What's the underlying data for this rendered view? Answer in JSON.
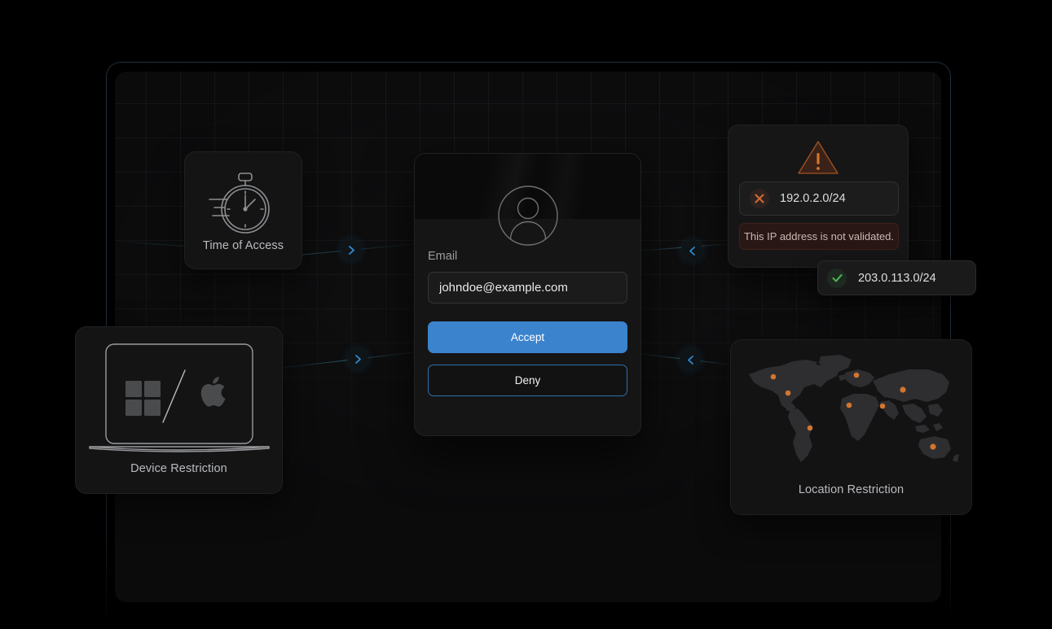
{
  "nodes": {
    "time_of_access": {
      "label": "Time of Access",
      "icon": "stopwatch-icon"
    },
    "device_restriction": {
      "label": "Device Restriction",
      "icon": "laptop-devices-icon"
    },
    "location_restriction": {
      "label": "Location Restriction",
      "icon": "world-map-icon"
    }
  },
  "consent_card": {
    "avatar_icon": "user-avatar-icon",
    "email_label": "Email",
    "email_value": "johndoe@example.com",
    "email_placeholder": "johndoe@example.com",
    "accept_label": "Accept",
    "deny_label": "Deny"
  },
  "ip_panel": {
    "warning_icon": "warning-triangle-icon",
    "invalid_icon": "x-mark-icon",
    "invalid_ip": "192.0.2.0/24",
    "error_message": "This IP address is not validated."
  },
  "ip_success": {
    "valid_icon": "check-mark-icon",
    "valid_ip": "203.0.113.0/24"
  },
  "connectors": [
    {
      "name": "time-to-consent",
      "direction": "right",
      "icon": "chevron-right-icon"
    },
    {
      "name": "device-to-consent",
      "direction": "right",
      "icon": "chevron-right-icon"
    },
    {
      "name": "ip-to-consent",
      "direction": "left",
      "icon": "chevron-left-icon"
    },
    {
      "name": "location-to-consent",
      "direction": "left",
      "icon": "chevron-left-icon"
    }
  ],
  "map_points": [
    {
      "x": 0.33,
      "y": 0.22
    },
    {
      "x": 0.53,
      "y": 0.4
    },
    {
      "x": 0.71,
      "y": 0.46
    },
    {
      "x": 0.52,
      "y": 0.21
    },
    {
      "x": 0.77,
      "y": 0.72
    },
    {
      "x": 0.88,
      "y": 0.3
    },
    {
      "x": 0.14,
      "y": 0.22
    }
  ],
  "colors": {
    "accent_blue": "#3b83cc",
    "deny_border": "#2e6ea8",
    "warning_orange": "#c4682f",
    "success_green": "#4caf50",
    "error_bg": "#281715",
    "canvas": "#0b0b0c",
    "card": "#151516",
    "map_point": "#d2762f"
  }
}
